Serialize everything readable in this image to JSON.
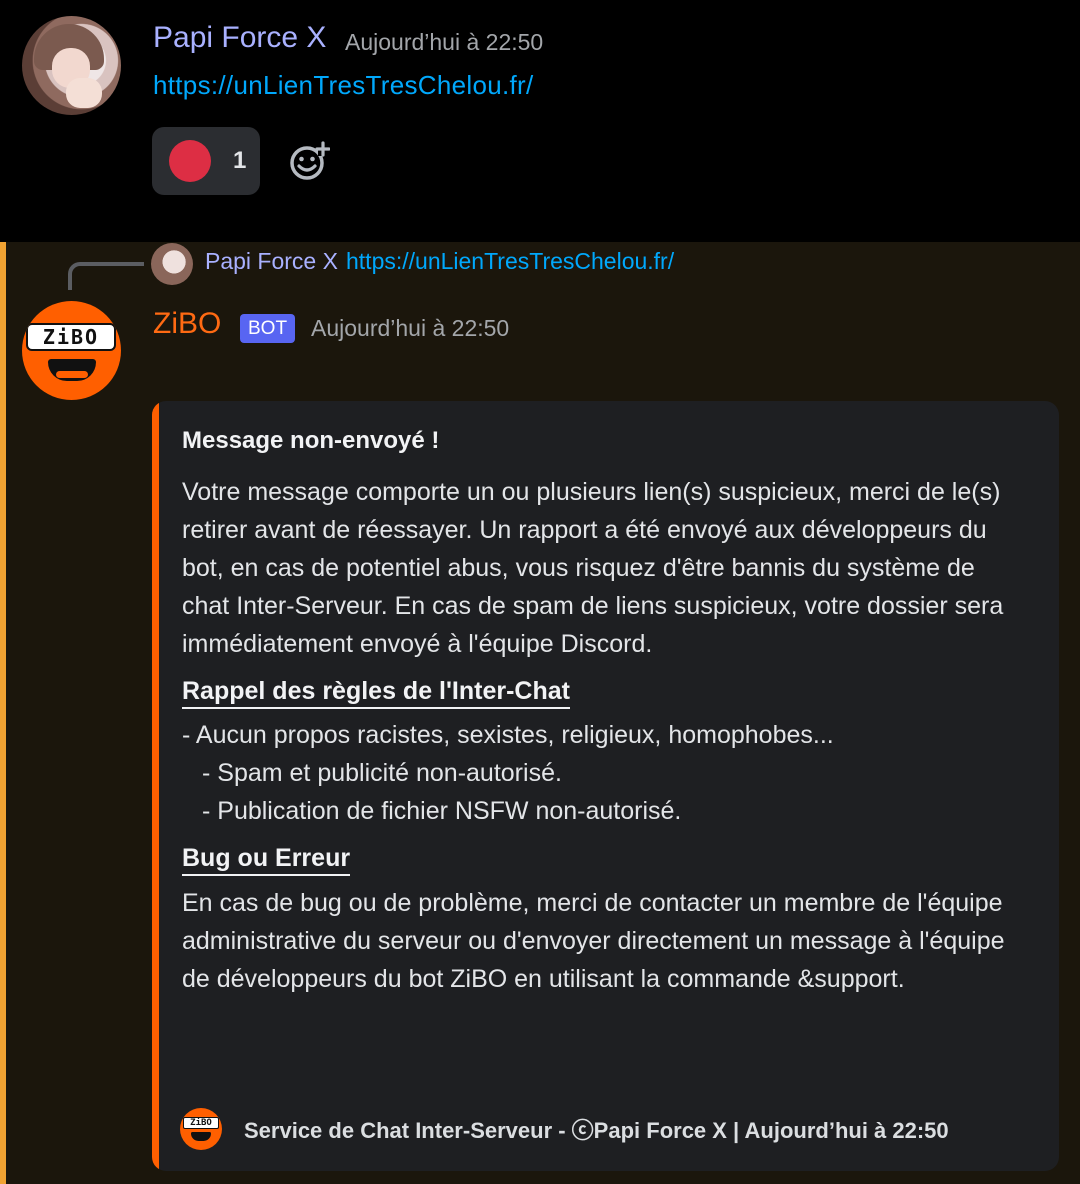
{
  "message1": {
    "author": "Papi Force X",
    "timestamp": "Aujourd’hui à 22:50",
    "link": "https://unLienTresTresChelou.fr/",
    "reaction": {
      "emoji_icon": "red-circle-icon",
      "count": "1"
    },
    "add_reaction_icon": "add-reaction-icon"
  },
  "message2": {
    "reply": {
      "author": "Papi Force X",
      "link": "https://unLienTresTresChelou.fr/"
    },
    "author": "ZiBO",
    "badge": "BOT",
    "timestamp": "Aujourd’hui à 22:50",
    "avatar_label": "ZiBO",
    "embed": {
      "title": "Message non-envoyé !",
      "description": "Votre message comporte un ou plusieurs lien(s) suspicieux, merci de le(s) retirer avant de réessayer. Un rapport a été envoyé aux développeurs du bot, en cas de potentiel abus, vous risquez d'être bannis du système de chat Inter-Serveur. En cas de spam de liens suspicieux, votre dossier sera immédiatement envoyé à l'équipe Discord.",
      "field1_title": "Rappel des règles de l'Inter-Chat",
      "rules": [
        "- Aucun propos racistes, sexistes, religieux, homophobes...",
        "- Spam et publicité non-autorisé.",
        "- Publication de fichier NSFW non-autorisé."
      ],
      "field2_title": "Bug ou Erreur",
      "field2_text": "En cas de bug ou de problème, merci de contacter un membre de l'équipe administrative du serveur ou d'envoyer directement un message à l'équipe de développeurs du bot ZiBO en utilisant la commande &support.",
      "footer": "Service de Chat Inter-Serveur - ⓒPapi Force X | Aujourd’hui à 22:50"
    }
  },
  "colors": {
    "username": "#a9b1ff",
    "link": "#00a8fc",
    "bot_accent": "#ff5f00",
    "bot_badge": "#5865f2",
    "reaction": "#dd2e44"
  }
}
